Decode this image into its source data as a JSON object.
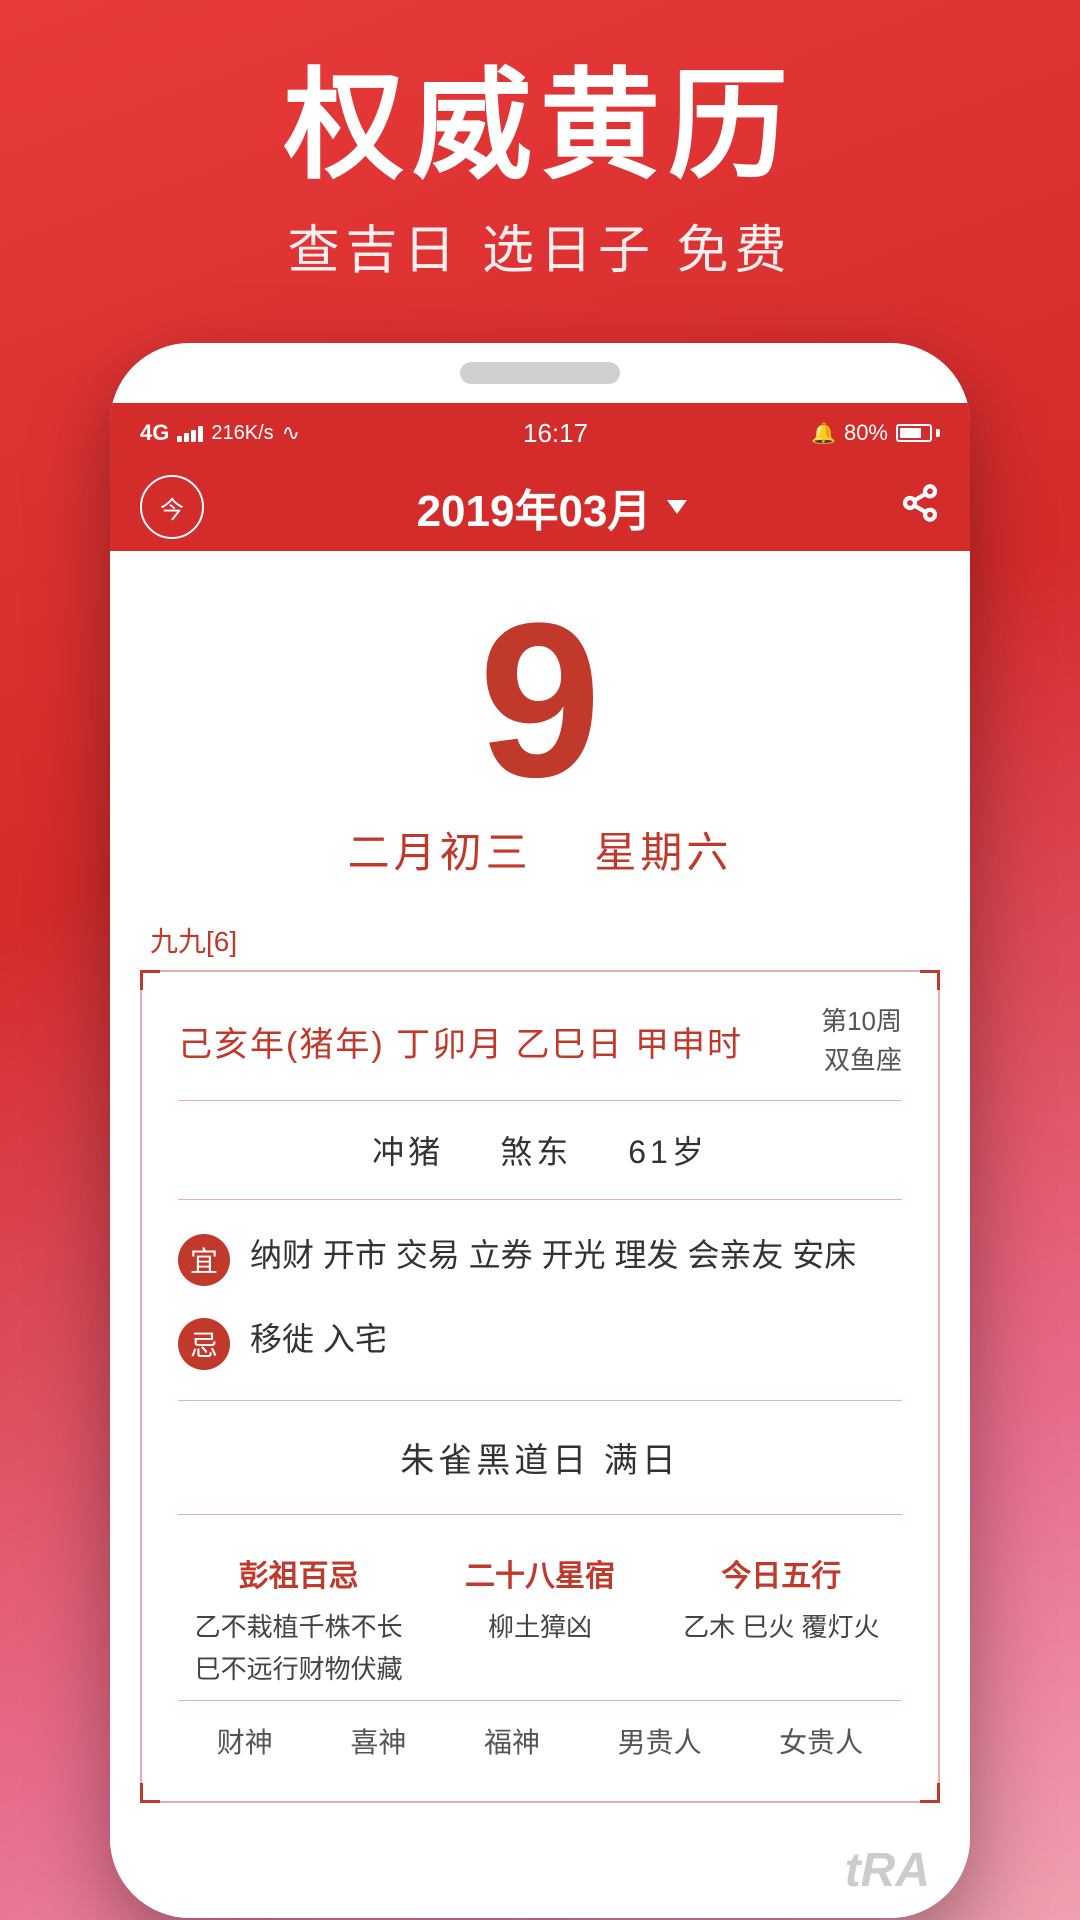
{
  "promo": {
    "title": "权威黄历",
    "subtitle": "查吉日 选日子 免费"
  },
  "status_bar": {
    "signal": "4G",
    "speed": "216K/s",
    "time": "16:17",
    "battery": "80%"
  },
  "app_header": {
    "today_label": "今",
    "month_title": "2019年03月",
    "triangle": "▼"
  },
  "date_display": {
    "day": "9",
    "lunar": "二月初三",
    "weekday": "星期六"
  },
  "nine_nine": "九九[6]",
  "detail": {
    "ganzhi": "己亥年(猪年) 丁卯月 乙巳日 甲申时",
    "week_info": "第10周",
    "zodiac": "双鱼座",
    "chong": "冲猪",
    "sha": "煞东",
    "age": "61岁",
    "yi_label": "宜",
    "yi_text": "纳财 开市 交易 立券 开光 理发 会亲友 安床",
    "ji_label": "忌",
    "ji_text": "移徙 入宅",
    "zhaque": "朱雀黑道日  满日",
    "pengzu_title": "彭祖百忌",
    "pengzu_content": "乙不栽植千株不长\n巳不远行财物伏藏",
    "xiu_title": "二十八星宿",
    "xiu_content": "柳土獐凶",
    "wuxing_title": "今日五行",
    "wuxing_content": "乙木 巳火 覆灯火",
    "bottom_labels": [
      "财神",
      "喜神",
      "福神",
      "男贵人",
      "女贵人"
    ]
  },
  "watermark": "tRA"
}
